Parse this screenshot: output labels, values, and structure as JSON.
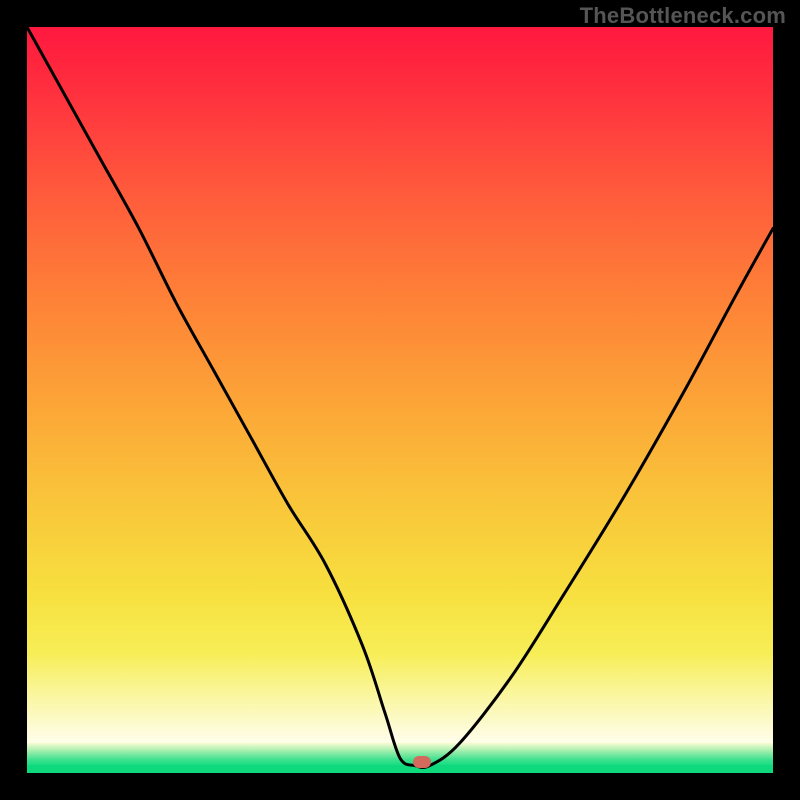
{
  "watermark": "TheBottleneck.com",
  "chart_data": {
    "type": "line",
    "title": "",
    "xlabel": "",
    "ylabel": "",
    "xlim": [
      0,
      100
    ],
    "ylim": [
      0,
      100
    ],
    "grid": false,
    "legend": false,
    "background": {
      "type": "vertical-gradient",
      "stops": [
        {
          "pos": 0,
          "color": "#ff183f"
        },
        {
          "pos": 50,
          "color": "#fca437"
        },
        {
          "pos": 80,
          "color": "#f7e545"
        },
        {
          "pos": 95,
          "color": "#fefde6"
        },
        {
          "pos": 97,
          "color": "#7de9a2"
        },
        {
          "pos": 100,
          "color": "#0fd97d"
        }
      ]
    },
    "series": [
      {
        "name": "bottleneck-curve",
        "color": "#000000",
        "x": [
          0,
          5,
          10,
          15,
          20,
          25,
          30,
          35,
          40,
          45,
          48,
          50,
          52,
          54,
          58,
          65,
          72,
          80,
          88,
          95,
          100
        ],
        "y": [
          100,
          91,
          82,
          73,
          63,
          54,
          45,
          36,
          28,
          17,
          8,
          2,
          1,
          1,
          4,
          13,
          24,
          37,
          51,
          64,
          73
        ]
      }
    ],
    "marker": {
      "x": 53,
      "y": 1.5,
      "shape": "pill",
      "color": "#d46a5e"
    }
  }
}
